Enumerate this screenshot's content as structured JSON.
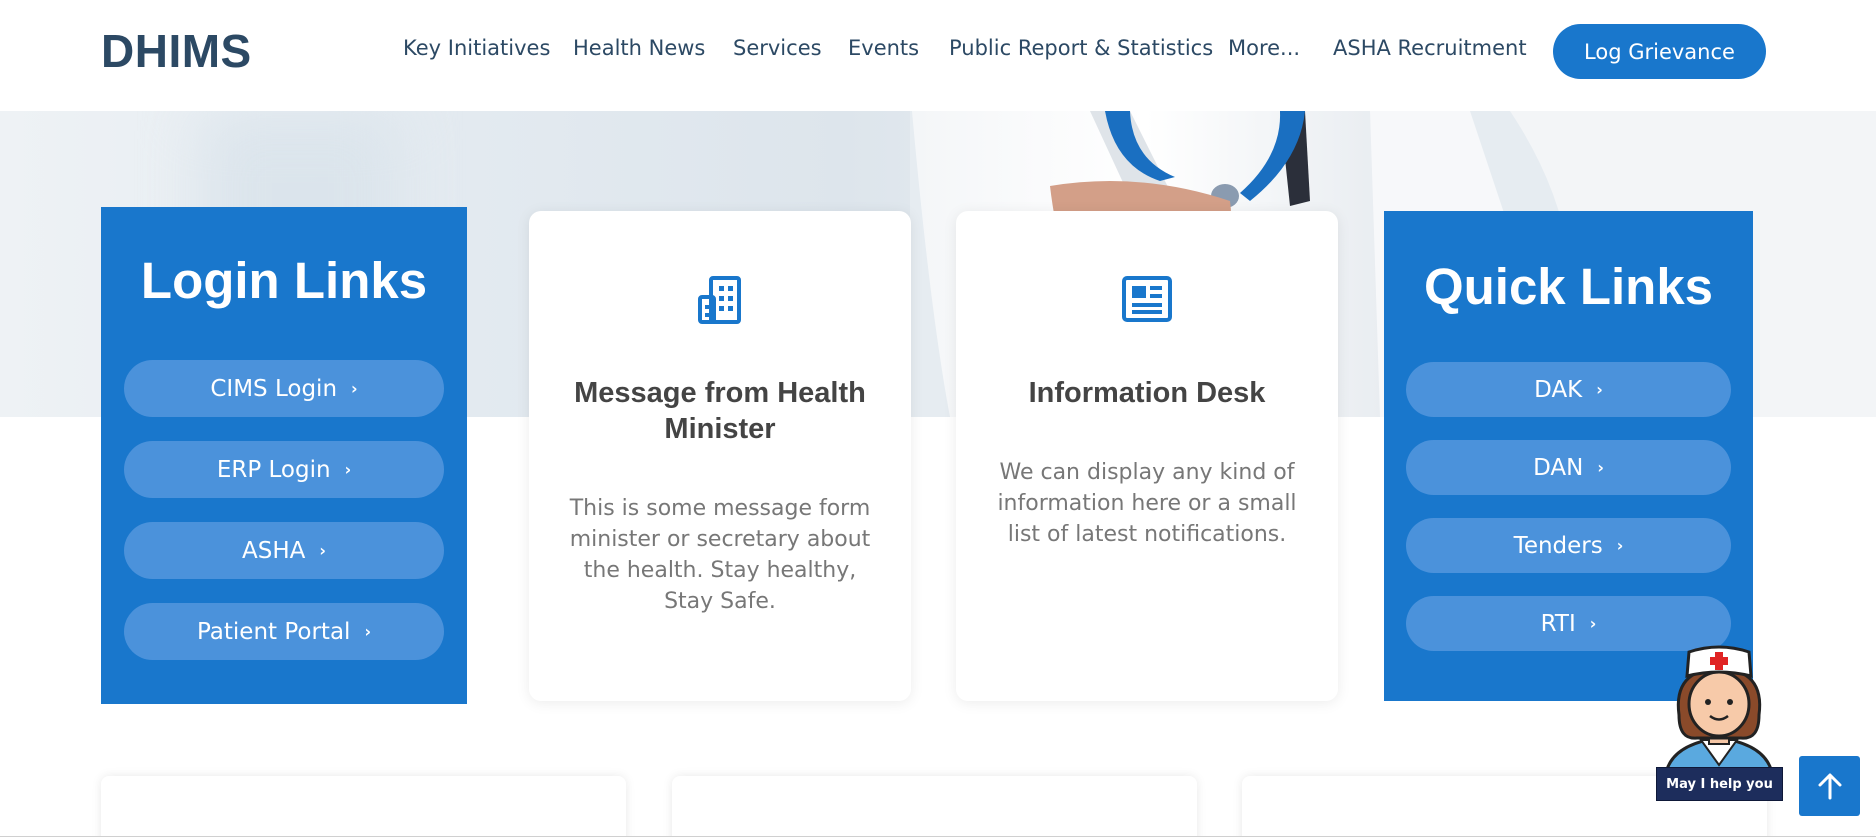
{
  "header": {
    "logo": "DHIMS",
    "nav": [
      "Key Initiatives",
      "Health News",
      "Services",
      "Events",
      "Public Report & Statistics",
      "More...",
      "ASHA Recruitment"
    ],
    "cta_label": "Log Grievance"
  },
  "login_links": {
    "title": "Login Links",
    "items": [
      "CIMS Login",
      "ERP Login",
      "ASHA",
      "Patient Portal"
    ]
  },
  "cards": [
    {
      "icon": "building-icon",
      "title": "Message from Health Minister",
      "text": "This is some message form minister or secretary about the health. Stay healthy, Stay Safe."
    },
    {
      "icon": "newspaper-icon",
      "title": "Information Desk",
      "text": "We can display any kind of information here or a small list of latest notifications."
    }
  ],
  "quick_links": {
    "title": "Quick Links",
    "items": [
      "DAK",
      "DAN",
      "Tenders",
      "RTI"
    ]
  },
  "helper": {
    "label": "May I help you",
    "icon": "nurse-avatar"
  },
  "back_to_top_icon": "arrow-up-icon",
  "colors": {
    "primary": "#1977cc",
    "pill": "#4b92db",
    "heading": "#2c4964"
  }
}
